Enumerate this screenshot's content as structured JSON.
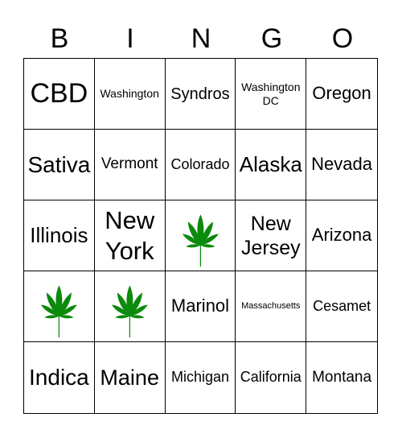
{
  "header": [
    "B",
    "I",
    "N",
    "G",
    "O"
  ],
  "leaf_color": "#0b8a0b",
  "cells": [
    {
      "text": "CBD"
    },
    {
      "text": "Washington"
    },
    {
      "text": "Syndros"
    },
    {
      "text": "Washington DC"
    },
    {
      "text": "Oregon"
    },
    {
      "text": "Sativa"
    },
    {
      "text": "Vermont"
    },
    {
      "text": "Colorado"
    },
    {
      "text": "Alaska"
    },
    {
      "text": "Nevada"
    },
    {
      "text": "Illinois"
    },
    {
      "text": "New York"
    },
    {
      "text": "",
      "icon": "cannabis-leaf-icon"
    },
    {
      "text": "New Jersey"
    },
    {
      "text": "Arizona"
    },
    {
      "text": "",
      "icon": "cannabis-leaf-icon"
    },
    {
      "text": "",
      "icon": "cannabis-leaf-icon"
    },
    {
      "text": "Marinol"
    },
    {
      "text": "Massachusetts"
    },
    {
      "text": "Cesamet"
    },
    {
      "text": "Indica"
    },
    {
      "text": "Maine"
    },
    {
      "text": "Michigan"
    },
    {
      "text": "California"
    },
    {
      "text": "Montana"
    }
  ]
}
